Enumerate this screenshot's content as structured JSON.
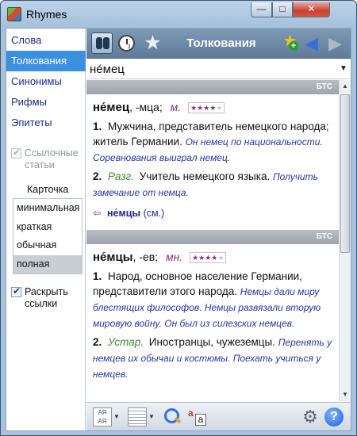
{
  "window": {
    "title": "Rhymes",
    "buttons": {
      "minimize": "—",
      "maximize": "□",
      "close": "✕"
    }
  },
  "sidebar": {
    "items": [
      {
        "label": "Слова",
        "active": false
      },
      {
        "label": "Толкования",
        "active": true
      },
      {
        "label": "Синонимы",
        "active": false
      },
      {
        "label": "Рифмы",
        "active": false
      },
      {
        "label": "Эпитеты",
        "active": false
      }
    ],
    "ref_articles": {
      "label": "Ссылочные статьи",
      "checked": true,
      "disabled": true
    },
    "card": {
      "label": "Карточка",
      "options": [
        "минимальная",
        "краткая",
        "обычная",
        "полная"
      ],
      "selected": "полная"
    },
    "expand_links": {
      "label": "Раскрыть ссылки",
      "checked": true
    }
  },
  "toolbar": {
    "title": "Толкования",
    "icons": [
      "binoculars-icon",
      "clock-icon",
      "star-icon",
      "add-favorite-icon",
      "back-arrow-icon",
      "forward-arrow-icon"
    ]
  },
  "search": {
    "value": "не́мец"
  },
  "entries": [
    {
      "source": "БТС",
      "headword": "не́мец",
      "forms": ", -мца;",
      "pos": "м.",
      "rating": 4,
      "senses": [
        {
          "num": "1.",
          "mark": "",
          "text": "Мужчина, представитель немецкого народа; житель Германии.",
          "example": "Он немец по национальности. Соревнования выиграл немец."
        },
        {
          "num": "2.",
          "mark": "Разг.",
          "text": "Учитель немецкого языка.",
          "example": "Получить замечание от немца."
        }
      ],
      "xref": {
        "arrow": "⇦",
        "word": "не́мцы",
        "note": "(см.)"
      }
    },
    {
      "source": "БТС",
      "headword": "не́мцы",
      "forms": ", -ев;",
      "pos": "мн.",
      "rating": 4,
      "senses": [
        {
          "num": "1.",
          "mark": "",
          "text": "Народ, основное население Германии, представители этого народа.",
          "example": "Немцы дали миру блестящих философов. Немцы развязали вторую мировую войну. Он был из силезских немцев."
        },
        {
          "num": "2.",
          "mark": "Устар.",
          "text": "Иностранцы, чужеземцы.",
          "example": "Перенять у немцев их обычаи и костюмы. Поехать учиться у немцев."
        }
      ]
    }
  ],
  "bottombar": {
    "font_button": "АЯ АЯ",
    "case_button": {
      "a1": "a",
      "a2": "a"
    },
    "help": "?",
    "settings_icon": "gear-icon"
  },
  "colors": {
    "accent": "#3d8fe0",
    "link": "#1c2a8c",
    "example": "#2336a3",
    "pos": "#8b2d84",
    "mark": "#3c8d2f"
  }
}
